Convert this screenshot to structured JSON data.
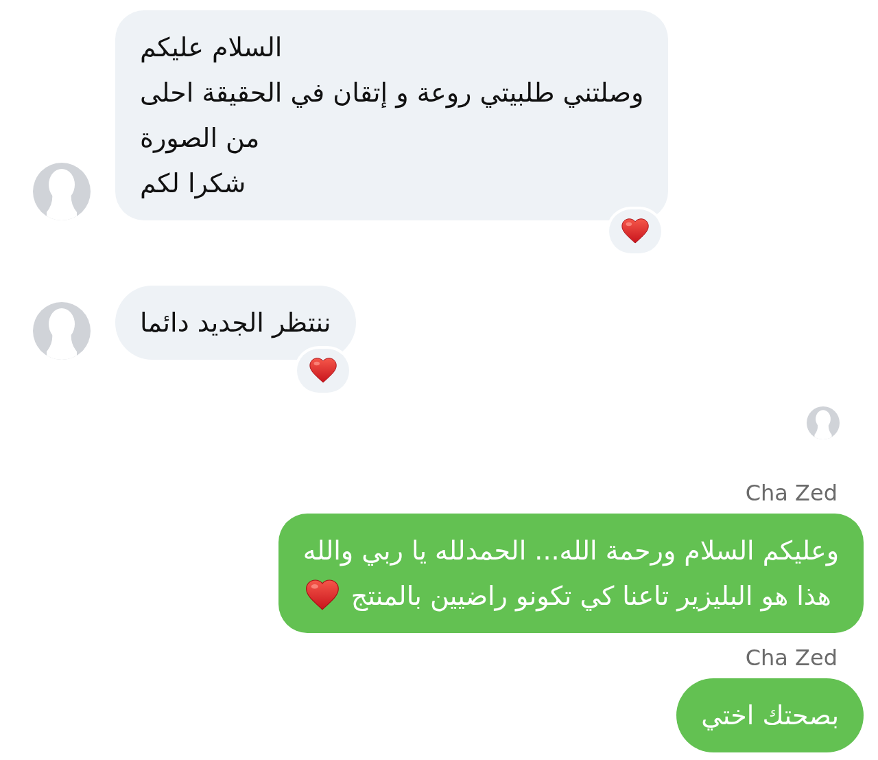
{
  "messages": [
    {
      "kind": "incoming",
      "lines": [
        "السلام عليكم",
        "وصلتني طلبيتي روعة و إتقان في الحقيقة احلى",
        "من الصورة",
        "شكرا لكم"
      ],
      "reacted": true
    },
    {
      "kind": "incoming",
      "lines": [
        "ننتظر الجديد دائما"
      ],
      "reacted": true
    },
    {
      "kind": "read_avatar"
    },
    {
      "kind": "outgoing",
      "sender": "Cha Zed",
      "lines": [
        "وعليكم السلام ورحمة الله... الحمدلله يا ربي والله",
        "هذا هو البليزير تاعنا كي تكونو راضيين بالمنتج"
      ],
      "heart_emoji": true
    },
    {
      "kind": "outgoing",
      "sender": "Cha Zed",
      "lines": [
        "بصحتك اختي"
      ],
      "heart_emoji": false
    }
  ]
}
